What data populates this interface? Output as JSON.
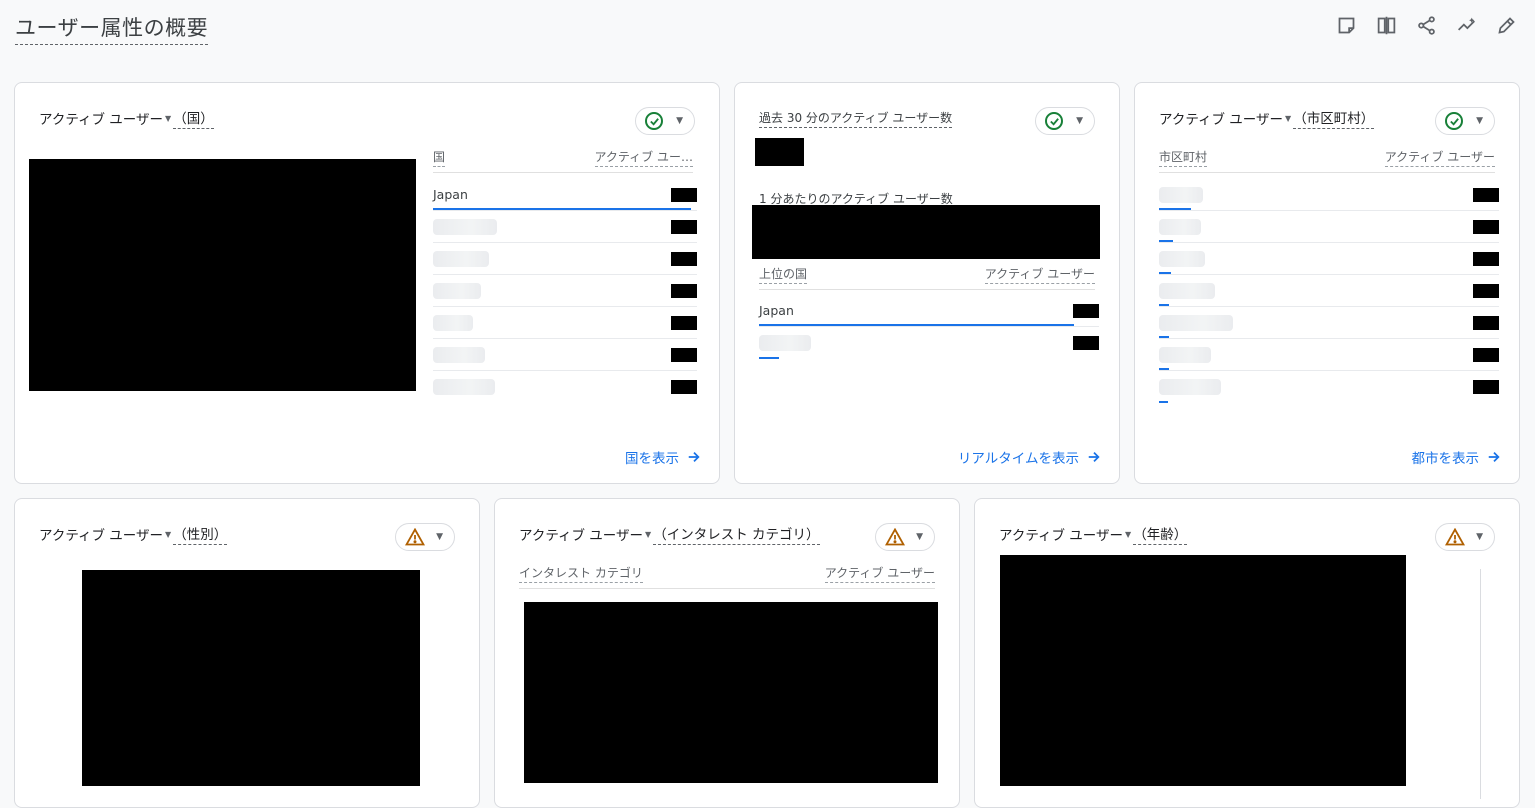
{
  "page": {
    "title": "ユーザー属性の概要"
  },
  "toolbar": {
    "icons": [
      "notes-icon",
      "compare-icon",
      "share-icon",
      "insights-icon",
      "edit-icon"
    ]
  },
  "colors": {
    "accent": "#1a73e8",
    "ok": "#188038",
    "warning": "#b06000"
  },
  "cards": {
    "country": {
      "metric": "アクティブ ユーザー",
      "dimension": "（国）",
      "status": "ok",
      "table": {
        "col1": "国",
        "col2": "アクティブ ユー…",
        "rows": [
          {
            "label": "Japan"
          }
        ]
      },
      "link": "国を表示"
    },
    "realtime": {
      "title": "過去 30 分のアクティブ ユーザー数",
      "per_minute_label": "1 分あたりのアクティブ ユーザー数",
      "status": "ok",
      "table": {
        "col1": "上位の国",
        "col2": "アクティブ ユーザー",
        "rows": [
          {
            "label": "Japan"
          }
        ]
      },
      "link": "リアルタイムを表示"
    },
    "city": {
      "metric": "アクティブ ユーザー",
      "dimension": "（市区町村）",
      "status": "ok",
      "table": {
        "col1": "市区町村",
        "col2": "アクティブ ユーザー"
      },
      "link": "都市を表示"
    },
    "gender": {
      "metric": "アクティブ ユーザー",
      "dimension": "（性別）",
      "status": "warning"
    },
    "interest": {
      "metric": "アクティブ ユーザー",
      "dimension": "（インタレスト カテゴリ）",
      "status": "warning",
      "table": {
        "col1": "インタレスト カテゴリ",
        "col2": "アクティブ ユーザー"
      }
    },
    "age": {
      "metric": "アクティブ ユーザー",
      "dimension": "（年齢）",
      "status": "warning"
    }
  }
}
